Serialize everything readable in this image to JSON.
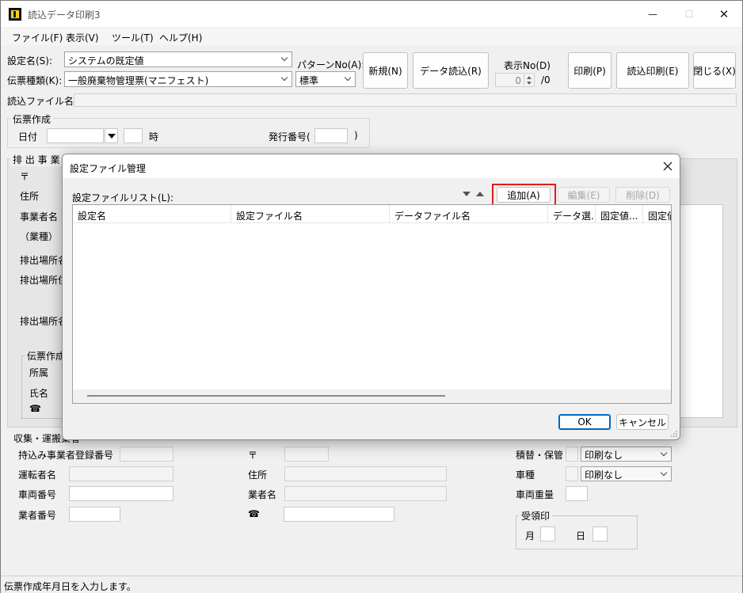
{
  "window": {
    "title": "読込データ印刷3",
    "minimize_glyph": "—",
    "maximize_glyph": "☐",
    "close_glyph": "✕"
  },
  "menu": [
    "ファイル(F)",
    "表示(V)",
    "ツール(T)",
    "ヘルプ(H)"
  ],
  "top_form": {
    "setting_name_label": "設定名(S):",
    "setting_name_value": "システムの既定値",
    "form_type_label": "伝票種類(K):",
    "form_type_value": "一般廃棄物管理票(マニフェスト)",
    "pattern_label": "パターンNo(A):",
    "pattern_value": "標準",
    "display_no_label": "表示No(D)",
    "display_no_value": "0",
    "display_no_total": "/0",
    "read_file_label": "読込ファイル名"
  },
  "toolbar": {
    "new_label": "新規(N)",
    "read_data_label": "データ読込(R)",
    "print_label": "印刷(P)",
    "read_print_label": "読込印刷(E)",
    "close_label": "閉じる(X)"
  },
  "slip": {
    "caption": "伝票作成",
    "date_label": "日付",
    "hour_label": "時",
    "issue_no_label": "発行番号(",
    "issue_no_close": ")"
  },
  "emitter": {
    "caption": "排 出 事 業 者",
    "postal_mark": "〒",
    "address_label": "住所",
    "business_name_label": "事業者名",
    "industry_label": "（業種）",
    "site_label_1": "排出場所名",
    "site_label_2": "排出場所住所",
    "site_label_3": "排出場所名",
    "slip_creator_caption": "伝票作成者",
    "dept_label": "所属",
    "name_label": "氏名",
    "tel_mark": "☎"
  },
  "transport": {
    "caption": "収集・運搬業者",
    "reg_no_label": "持込み事業者登録番号",
    "driver_label": "運転者名",
    "vehicle_no_label": "車両番号",
    "vendor_no_label": "業者番号",
    "postal_mark": "〒",
    "address_label": "住所",
    "vendor_name_label": "業者名",
    "tel_mark": "☎",
    "transship_label": "積替・保管",
    "transship_value": "印刷なし",
    "vehicle_type_label": "車種",
    "vehicle_type_value": "印刷なし",
    "vehicle_weight_label": "車両重量",
    "receipt_caption": "受領印",
    "month_label": "月",
    "day_label": "日"
  },
  "dialog": {
    "title": "設定ファイル管理",
    "list_label": "設定ファイルリスト(L):",
    "add_label": "追加(A)",
    "edit_label": "編集(E)",
    "delete_label": "削除(D)",
    "columns": [
      "設定名",
      "設定ファイル名",
      "データファイル名",
      "データ選...",
      "固定値...",
      "固定値"
    ],
    "ok_label": "OK",
    "cancel_label": "キャンセル"
  },
  "status_text": "伝票作成年月日を入力します。",
  "colors": {
    "highlight": "#e11c1c",
    "window_bg": "#f0f0f0"
  }
}
